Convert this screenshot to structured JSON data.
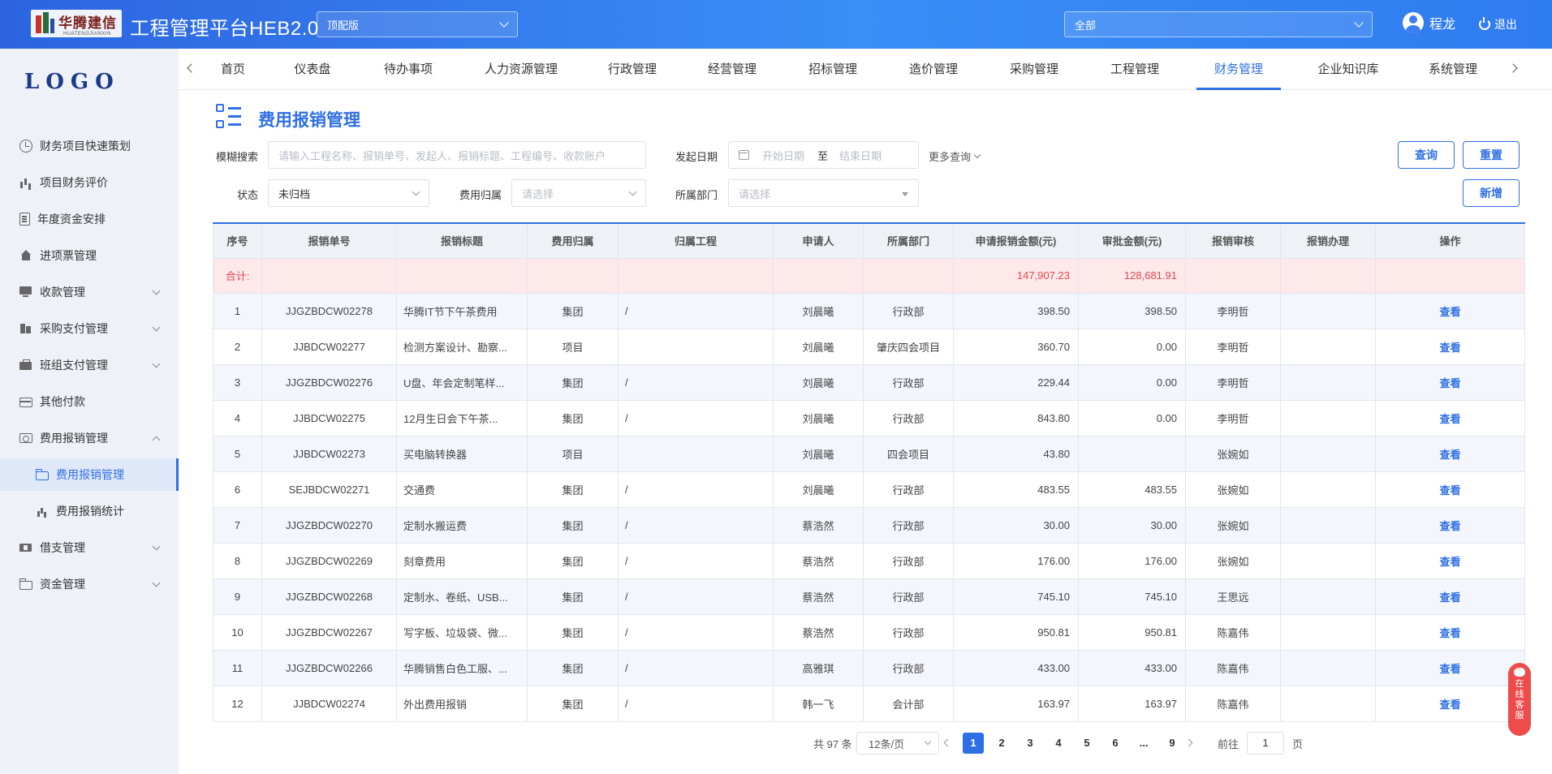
{
  "header": {
    "logo_text": "华腾建信",
    "logo_sub": "HUATENGJIANXIN",
    "app_title": "工程管理平台HEB2.0",
    "edition_select": "顶配版",
    "scope_select": "全部",
    "user_name": "程龙",
    "logout_label": "退出"
  },
  "sidebar": {
    "logo": "LOGO",
    "items": [
      {
        "label": "财务项目快速策划",
        "icon": "clock-icon"
      },
      {
        "label": "项目财务评价",
        "icon": "bar-chart-icon"
      },
      {
        "label": "年度资金安排",
        "icon": "document-icon"
      },
      {
        "label": "进项票管理",
        "icon": "home-icon"
      },
      {
        "label": "收款管理",
        "icon": "monitor-icon"
      },
      {
        "label": "采购支付管理",
        "icon": "building-icon"
      },
      {
        "label": "班组支付管理",
        "icon": "briefcase-icon"
      },
      {
        "label": "其他付款",
        "icon": "card-icon"
      },
      {
        "label": "费用报销管理",
        "icon": "receipt-icon"
      },
      {
        "label": "费用报销管理",
        "icon": "folder-icon"
      },
      {
        "label": "费用报销统计",
        "icon": "bar-chart-icon"
      },
      {
        "label": "借支管理",
        "icon": "ticket-icon"
      },
      {
        "label": "资金管理",
        "icon": "folder-icon"
      }
    ]
  },
  "topnav": {
    "tabs": [
      "首页",
      "仪表盘",
      "待办事项",
      "人力资源管理",
      "行政管理",
      "经营管理",
      "招标管理",
      "造价管理",
      "采购管理",
      "工程管理",
      "财务管理",
      "企业知识库",
      "系统管理"
    ],
    "active": "财务管理"
  },
  "page": {
    "title": "费用报销管理"
  },
  "filters": {
    "fuzzy_label": "模糊搜索",
    "fuzzy_placeholder": "请输入工程名称、报销单号、发起人、报销标题、工程编号、收款账户",
    "date_label": "发起日期",
    "date_start": "开始日期",
    "date_sep": "至",
    "date_end": "结束日期",
    "more": "更多查询",
    "status_label": "状态",
    "status_value": "未归档",
    "belong_label": "费用归属",
    "belong_placeholder": "请选择",
    "dept_label": "所属部门",
    "dept_placeholder": "请选择",
    "query_btn": "查询",
    "reset_btn": "重置",
    "add_btn": "新增"
  },
  "table": {
    "columns": [
      "序号",
      "报销单号",
      "报销标题",
      "费用归属",
      "归属工程",
      "申请人",
      "所属部门",
      "申请报销金额(元)",
      "审批金额(元)",
      "报销审核",
      "报销办理",
      "操作"
    ],
    "summary": {
      "label": "合计:",
      "apply_total": "147,907.23",
      "approve_total": "128,681.91"
    },
    "rows": [
      [
        "1",
        "JJGZBDCW02278",
        "华腾IT节下午茶费用",
        "集团",
        "/",
        "刘晨曦",
        "行政部",
        "398.50",
        "398.50",
        "李明哲",
        "",
        "查看"
      ],
      [
        "2",
        "JJBDCW02277",
        "检测方案设计、勘察...",
        "项目",
        "",
        "刘晨曦",
        "肇庆四会项目",
        "360.70",
        "0.00",
        "李明哲",
        "",
        "查看"
      ],
      [
        "3",
        "JJGZBDCW02276",
        "U盘、年会定制笔样...",
        "集团",
        "/",
        "刘晨曦",
        "行政部",
        "229.44",
        "0.00",
        "李明哲",
        "",
        "查看"
      ],
      [
        "4",
        "JJBDCW02275",
        "12月生日会下午茶...",
        "集团",
        "/",
        "刘晨曦",
        "行政部",
        "843.80",
        "0.00",
        "李明哲",
        "",
        "查看"
      ],
      [
        "5",
        "JJBDCW02273",
        "买电脑转换器",
        "项目",
        "",
        "刘晨曦",
        "四会项目",
        "43.80",
        "",
        "张婉如",
        "",
        "查看"
      ],
      [
        "6",
        "SEJBDCW02271",
        "交通费",
        "集团",
        "/",
        "刘晨曦",
        "行政部",
        "483.55",
        "483.55",
        "张婉如",
        "",
        "查看"
      ],
      [
        "7",
        "JJGZBDCW02270",
        "定制水搬运费",
        "集团",
        "/",
        "蔡浩然",
        "行政部",
        "30.00",
        "30.00",
        "张婉如",
        "",
        "查看"
      ],
      [
        "8",
        "JJGZBDCW02269",
        "刻章费用",
        "集团",
        "/",
        "蔡浩然",
        "行政部",
        "176.00",
        "176.00",
        "张婉如",
        "",
        "查看"
      ],
      [
        "9",
        "JJGZBDCW02268",
        "定制水、卷纸、USB...",
        "集团",
        "/",
        "蔡浩然",
        "行政部",
        "745.10",
        "745.10",
        "王思远",
        "",
        "查看"
      ],
      [
        "10",
        "JJGZBDCW02267",
        "写字板、垃圾袋、微...",
        "集团",
        "/",
        "蔡浩然",
        "行政部",
        "950.81",
        "950.81",
        "陈嘉伟",
        "",
        "查看"
      ],
      [
        "11",
        "JJGZBDCW02266",
        "华腾销售白色工服、...",
        "集团",
        "/",
        "高雅琪",
        "行政部",
        "433.00",
        "433.00",
        "陈嘉伟",
        "",
        "查看"
      ],
      [
        "12",
        "JJBDCW02274",
        "外出费用报销",
        "集团",
        "/",
        "韩一飞",
        "会计部",
        "163.97",
        "163.97",
        "陈嘉伟",
        "",
        "查看"
      ]
    ]
  },
  "pagination": {
    "total": "共 97 条",
    "page_size": "12条/页",
    "pages": [
      "1",
      "2",
      "3",
      "4",
      "5",
      "6",
      "...",
      "9"
    ],
    "current": "1",
    "goto_label": "前往",
    "goto_value": "1",
    "goto_suffix": "页"
  },
  "service": {
    "label": "在线客服"
  }
}
